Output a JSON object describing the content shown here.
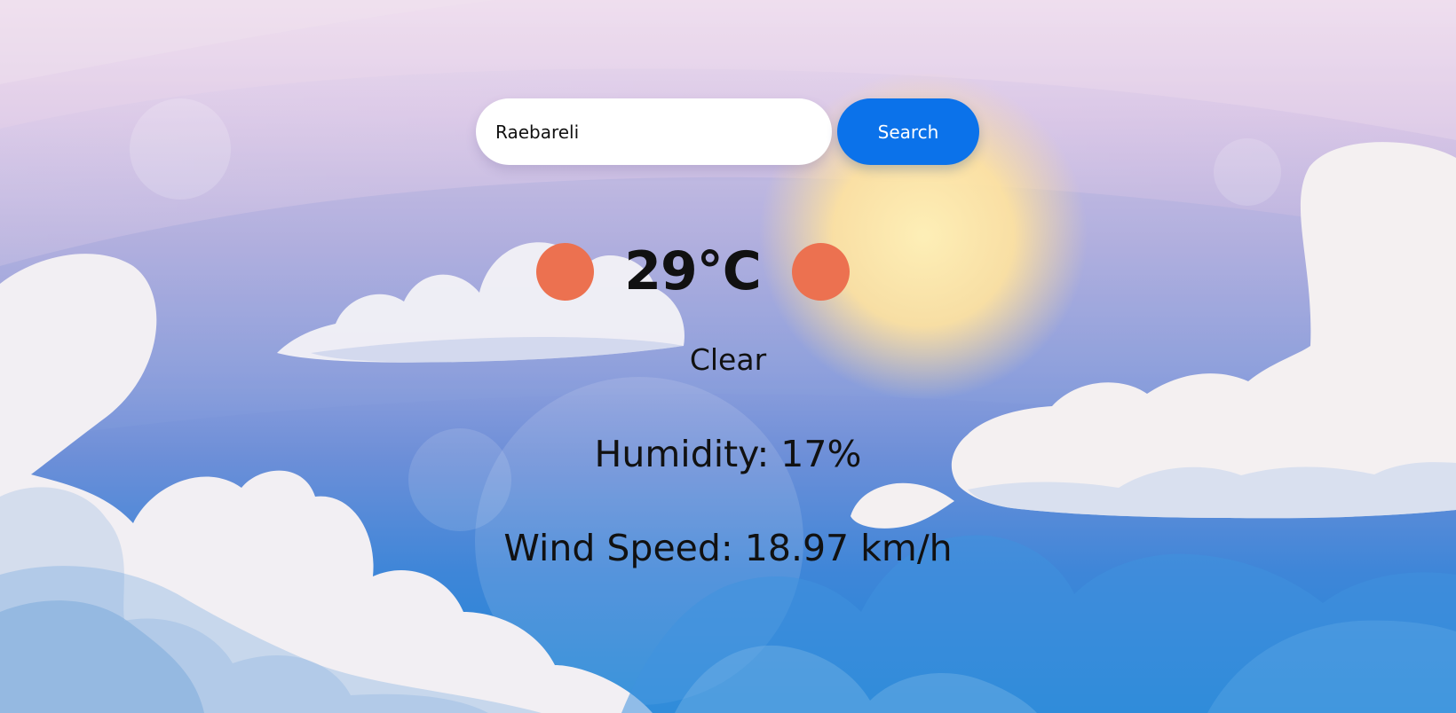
{
  "search": {
    "value": "Raebareli",
    "button_label": "Search"
  },
  "weather": {
    "temperature": "29°C",
    "condition": "Clear",
    "humidity": "Humidity: 17%",
    "wind_speed": "Wind Speed: 18.97 km/h",
    "icon_color": "#ec7150"
  },
  "theme": {
    "button_color": "#0b72ea",
    "text_color": "#111111"
  }
}
